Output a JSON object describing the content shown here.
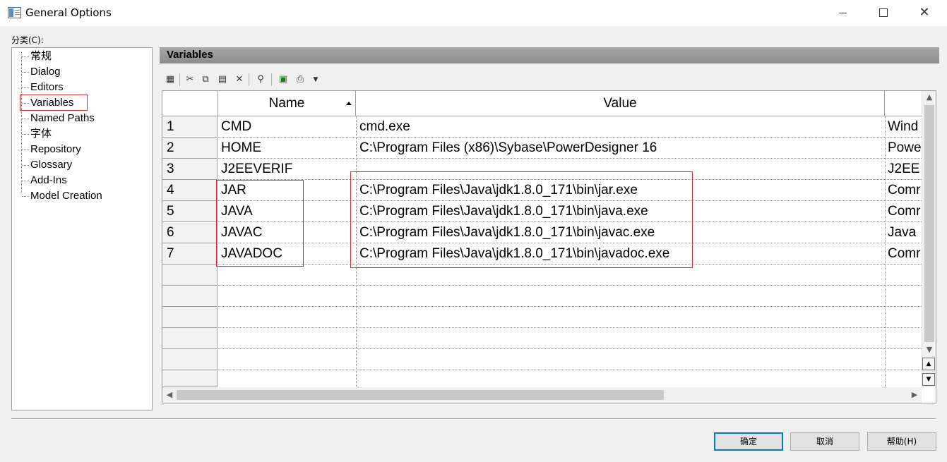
{
  "window": {
    "title": "General Options"
  },
  "category": {
    "label": "分类(C):",
    "items": [
      "常规",
      "Dialog",
      "Editors",
      "Variables",
      "Named Paths",
      "字体",
      "Repository",
      "Glossary",
      "Add-Ins",
      "Model Creation"
    ],
    "selected": "Variables"
  },
  "panel": {
    "title": "Variables"
  },
  "toolbar": {
    "icons": [
      "properties-icon",
      "cut-icon",
      "copy-icon",
      "paste-icon",
      "delete-icon",
      "find-icon",
      "excel-icon",
      "print-icon",
      "dropdown-icon"
    ]
  },
  "grid": {
    "columns": {
      "name": "Name",
      "value": "Value"
    },
    "rows": [
      {
        "num": "1",
        "name": "CMD",
        "value": "cmd.exe",
        "comment": "Wind"
      },
      {
        "num": "2",
        "name": "HOME",
        "value": "C:\\Program Files (x86)\\Sybase\\PowerDesigner 16",
        "comment": "Powe"
      },
      {
        "num": "3",
        "name": "J2EEVERIF",
        "value": "",
        "comment": "J2EE"
      },
      {
        "num": "4",
        "name": "JAR",
        "value": "C:\\Program Files\\Java\\jdk1.8.0_171\\bin\\jar.exe",
        "comment": "Comr"
      },
      {
        "num": "5",
        "name": "JAVA",
        "value": "C:\\Program Files\\Java\\jdk1.8.0_171\\bin\\java.exe",
        "comment": "Comr"
      },
      {
        "num": "6",
        "name": "JAVAC",
        "value": "C:\\Program Files\\Java\\jdk1.8.0_171\\bin\\javac.exe",
        "comment": "Java"
      },
      {
        "num": "7",
        "name": "JAVADOC",
        "value": "C:\\Program Files\\Java\\jdk1.8.0_171\\bin\\javadoc.exe",
        "comment": "Comr"
      }
    ]
  },
  "buttons": {
    "ok": "确定",
    "cancel": "取消",
    "help": "帮助(H)"
  },
  "colors": {
    "highlight": "#e0262b",
    "primary_border": "#0078d7"
  }
}
